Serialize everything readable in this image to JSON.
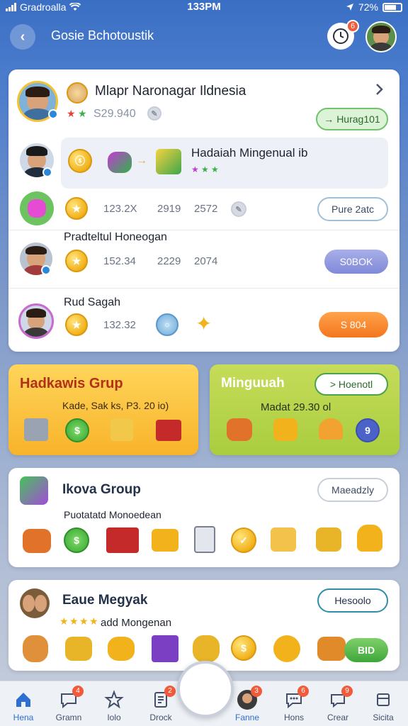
{
  "status": {
    "carrier": "Gradroalla",
    "time": "133PM",
    "battery": "72%"
  },
  "header": {
    "title": "Gosie Bchotoustik",
    "notif_count": "6"
  },
  "main_card": {
    "title": "Mlapr Naronagar Ildnesia",
    "score": "S29.940",
    "button": "Hurag101",
    "reward_title": "Hadaiah Mingenual ib",
    "row1": {
      "val1": "123.2X",
      "val2": "2919",
      "val3": "2572",
      "button": "Pure 2atc"
    },
    "row2": {
      "title": "Pradteltul Honeogan",
      "val1": "152.34",
      "val2": "2229",
      "val3": "2074",
      "button": "S0BOK"
    },
    "row3": {
      "title": "Rud Sagah",
      "val1": "132.32",
      "button": "S 804"
    }
  },
  "orange_card": {
    "title": "Hadkawis Grup",
    "subtitle": "Kade, Sak ks, P3. 20 io)"
  },
  "green_card": {
    "title": "Minguuah",
    "button": "> Hoenotl",
    "subtitle": "Madat 29.30 ol",
    "badge": "9"
  },
  "group_card": {
    "title": "Ikova Group",
    "button": "Maeadzly",
    "subtitle": "Puotatatd Monoedean"
  },
  "last_card": {
    "title": "Eaue Megyak",
    "subtitle": "add Mongenan",
    "button": "Hesoolo",
    "green_button": "BID"
  },
  "tabs": [
    {
      "label": "Hena",
      "badge": ""
    },
    {
      "label": "Gramn",
      "badge": "4"
    },
    {
      "label": "Iolo",
      "badge": ""
    },
    {
      "label": "Drock",
      "badge": "2"
    },
    {
      "label": "Fanne",
      "badge": "3"
    },
    {
      "label": "Hons",
      "badge": "6"
    },
    {
      "label": "Crear",
      "badge": "9"
    },
    {
      "label": "Sicita",
      "badge": ""
    }
  ]
}
